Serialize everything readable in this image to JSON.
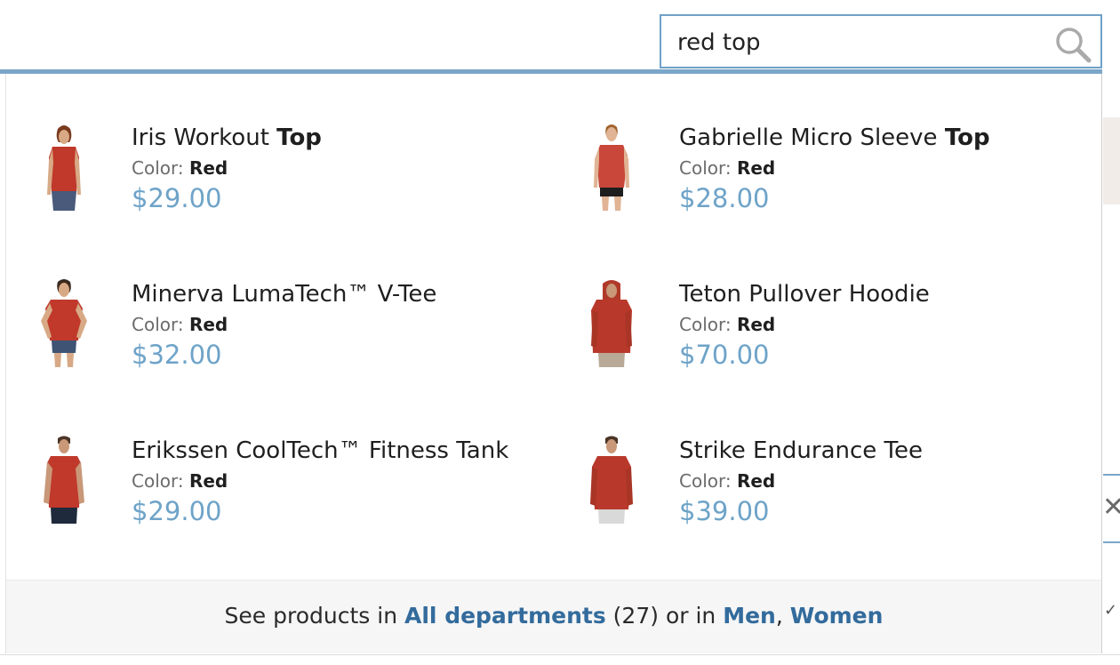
{
  "search": {
    "value": "red top",
    "icon": "search-icon"
  },
  "colors": {
    "accent": "#7aa6c9",
    "price": "#6ea3c8",
    "link": "#336b9c",
    "product_red": "#c0392b"
  },
  "products": [
    {
      "name_prefix": "Iris Workout ",
      "name_highlight": "Top",
      "color_label": "Color:",
      "color_value": "Red",
      "price": "$29.00"
    },
    {
      "name_prefix": "Gabrielle Micro Sleeve ",
      "name_highlight": "Top",
      "color_label": "Color:",
      "color_value": "Red",
      "price": "$28.00"
    },
    {
      "name_prefix": "Minerva LumaTech™ V-Tee",
      "name_highlight": "",
      "color_label": "Color:",
      "color_value": "Red",
      "price": "$32.00"
    },
    {
      "name_prefix": "Teton Pullover Hoodie",
      "name_highlight": "",
      "color_label": "Color:",
      "color_value": "Red",
      "price": "$70.00"
    },
    {
      "name_prefix": "Erikssen CoolTech™ Fitness Tank",
      "name_highlight": "",
      "color_label": "Color:",
      "color_value": "Red",
      "price": "$29.00"
    },
    {
      "name_prefix": "Strike Endurance Tee",
      "name_highlight": "",
      "color_label": "Color:",
      "color_value": "Red",
      "price": "$39.00"
    }
  ],
  "footer": {
    "prefix": "See products in ",
    "all_departments": "All departments",
    "count": " (27) or in ",
    "men": "Men",
    "separator": ", ",
    "women": "Women"
  }
}
